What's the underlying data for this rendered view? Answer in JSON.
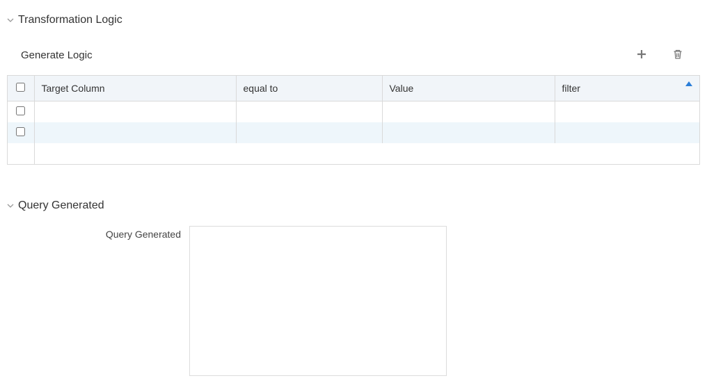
{
  "sections": {
    "transformation": {
      "title": "Transformation Logic",
      "toolbar_label": "Generate Logic"
    },
    "query": {
      "title": "Query Generated",
      "field_label": "Query Generated",
      "value": ""
    }
  },
  "table": {
    "headers": {
      "target_column": "Target Column",
      "equal_to": "equal to",
      "value": "Value",
      "filter": "filter"
    },
    "rows": [
      {
        "target_column": "",
        "equal_to": "",
        "value": "",
        "filter": ""
      },
      {
        "target_column": "",
        "equal_to": "",
        "value": "",
        "filter": ""
      }
    ]
  }
}
